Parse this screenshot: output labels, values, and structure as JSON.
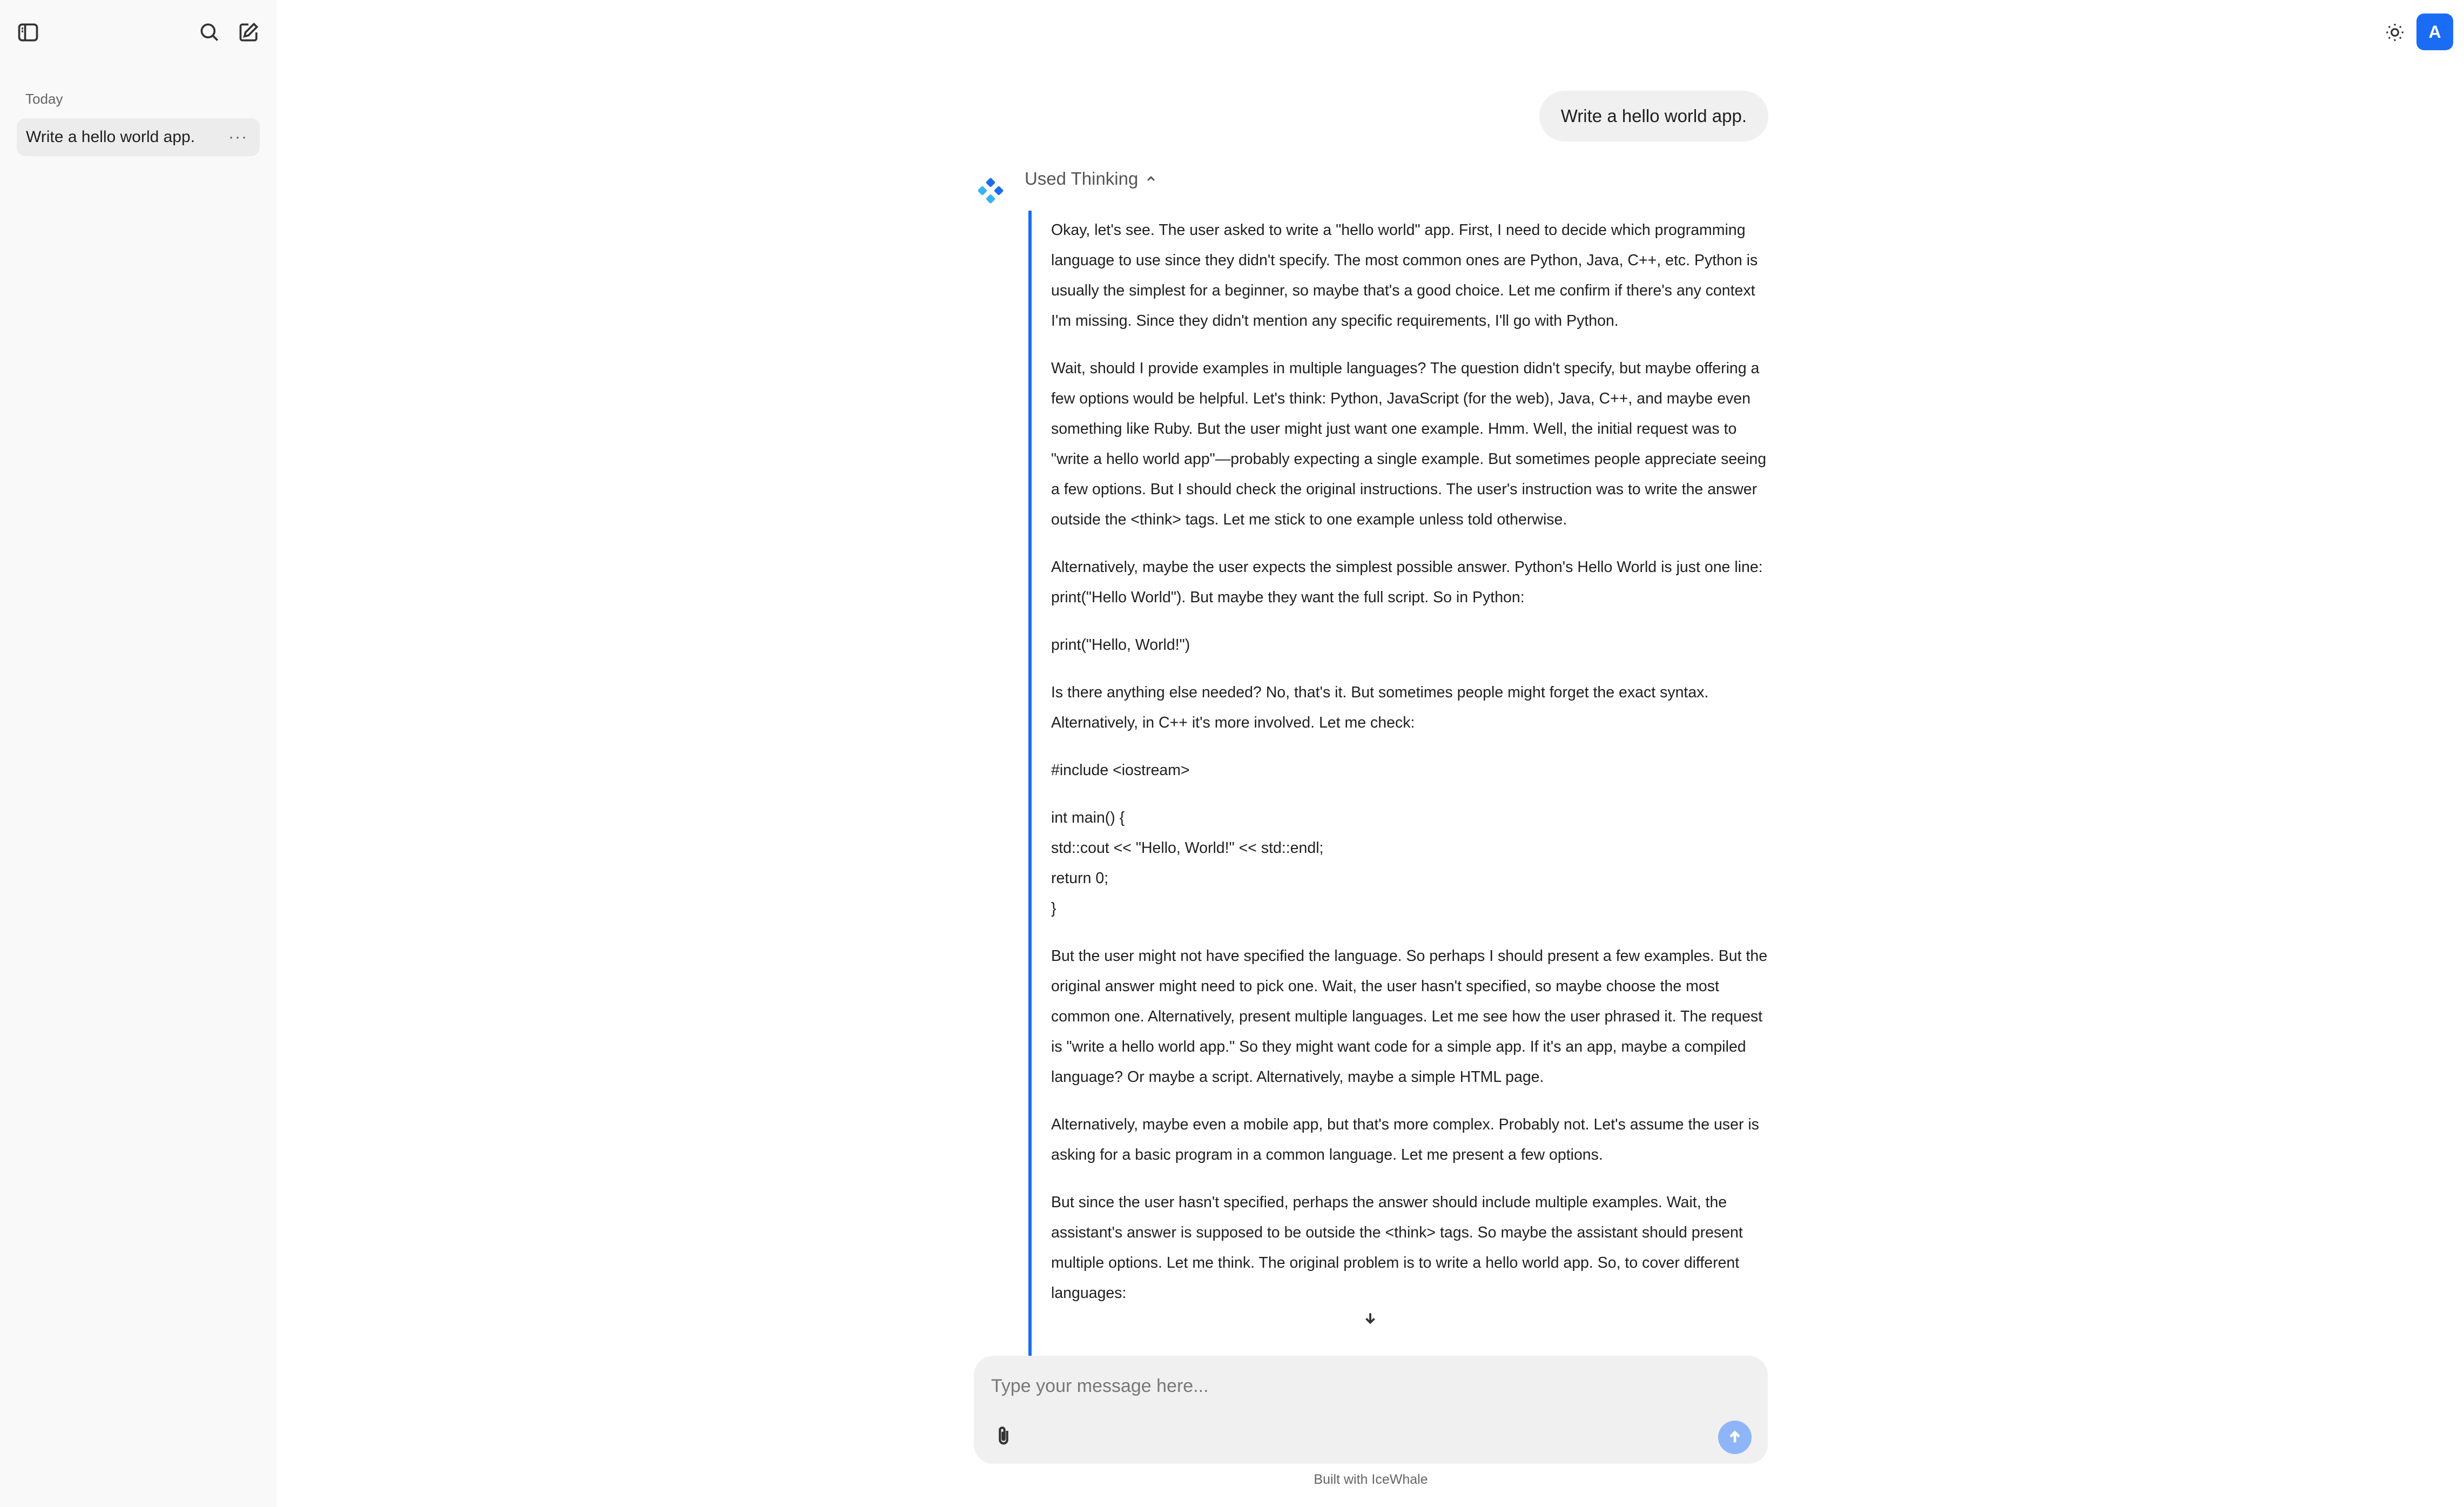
{
  "sidebar": {
    "section_label": "Today",
    "items": [
      {
        "label": "Write a hello world app.",
        "more": "···"
      }
    ]
  },
  "header": {
    "avatar_letter": "A",
    "accent_color": "#1a6cf5"
  },
  "conversation": {
    "user_message": "Write a hello world app.",
    "thinking_label": "Used Thinking",
    "thinking_paragraphs": [
      "Okay, let's see. The user asked to write a \"hello world\" app. First, I need to decide which programming language to use since they didn't specify. The most common ones are Python, Java, C++, etc. Python is usually the simplest for a beginner, so maybe that's a good choice. Let me confirm if there's any context I'm missing. Since they didn't mention any specific requirements, I'll go with Python.",
      "Wait, should I provide examples in multiple languages? The question didn't specify, but maybe offering a few options would be helpful. Let's think: Python, JavaScript (for the web), Java, C++, and maybe even something like Ruby. But the user might just want one example. Hmm. Well, the initial request was to \"write a hello world app\"—probably expecting a single example. But sometimes people appreciate seeing a few options. But I should check the original instructions. The user's instruction was to write the answer outside the <think> tags. Let me stick to one example unless told otherwise.",
      "Alternatively, maybe the user expects the simplest possible answer. Python's Hello World is just one line: print(\"Hello World\"). But maybe they want the full script. So in Python:",
      "print(\"Hello, World!\")",
      "Is there anything else needed? No, that's it. But sometimes people might forget the exact syntax. Alternatively, in C++ it's more involved. Let me check:",
      "#include <iostream>",
      "int main() {\nstd::cout << \"Hello, World!\" << std::endl;\nreturn 0;\n}",
      "But the user might not have specified the language. So perhaps I should present a few examples. But the original answer might need to pick one. Wait, the user hasn't specified, so maybe choose the most common one. Alternatively, present multiple languages. Let me see how the user phrased it. The request is \"write a hello world app.\" So they might want code for a simple app. If it's an app, maybe a compiled language? Or maybe a script. Alternatively, maybe a simple HTML page.",
      "Alternatively, maybe even a mobile app, but that's more complex. Probably not. Let's assume the user is asking for a basic program in a common language. Let me present a few options.",
      "But since the user hasn't specified, perhaps the answer should include multiple examples. Wait, the assistant's answer is supposed to be outside the <think> tags. So maybe the assistant should present multiple options. Let me think. The original problem is to write a hello world app. So, to cover different languages:"
    ]
  },
  "composer": {
    "placeholder": "Type your message here...",
    "value": ""
  },
  "footer": {
    "note": "Built with IceWhale"
  }
}
